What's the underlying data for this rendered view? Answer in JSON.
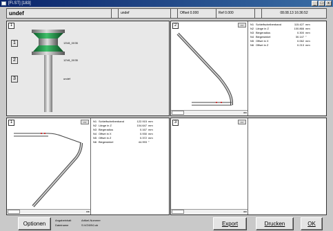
{
  "window": {
    "title": "[Fl.ST] [183]",
    "min_label": "_",
    "max_label": "□",
    "close_label": "x"
  },
  "header": {
    "title": "undef",
    "field1": "",
    "field2": "undef",
    "field3": "",
    "offset": "Offset 0.000",
    "ref": "Ref 0.000",
    "field6": "",
    "datetime": "08.08.13 16:36:52"
  },
  "panel1": {
    "number": "1",
    "items": [
      {
        "num": "1",
        "label": "13V8_0X35"
      },
      {
        "num": "2",
        "label": "12V8_0X35"
      },
      {
        "num": "3",
        "label": "undef"
      }
    ]
  },
  "panel2": {
    "number": "2",
    "expand_label": ">>",
    "scroll_label": "",
    "scroll_arrows": "◂ ▸",
    "rows": [
      {
        "k": "N1",
        "label": "Schleifscheibenband",
        "value": "115.427",
        "unit": "mm"
      },
      {
        "k": "N2",
        "label": "Länge in Z",
        "value": "100.866",
        "unit": "mm"
      },
      {
        "k": "N3",
        "label": "Biegeradius",
        "value": "0.300",
        "unit": "mm"
      },
      {
        "k": "N4",
        "label": "Biegewinkel",
        "value": "30.147",
        "unit": "°"
      },
      {
        "k": "N5",
        "label": "Offset in X",
        "value": "0.062",
        "unit": "mm"
      },
      {
        "k": "N6",
        "label": "Offset in Z",
        "value": "0.213",
        "unit": "mm"
      }
    ]
  },
  "panel3": {
    "number": "1",
    "expand_label": ">>",
    "scroll_label": "",
    "scroll_arrows": "◂ ▸",
    "rows": [
      {
        "k": "N1",
        "label": "Schleifscheibenband",
        "value": "122.915",
        "unit": "mm"
      },
      {
        "k": "N2",
        "label": "Länge in Z",
        "value": "104.647",
        "unit": "mm"
      },
      {
        "k": "N3",
        "label": "Biegeradius",
        "value": "0.167",
        "unit": "mm"
      },
      {
        "k": "N4",
        "label": "Offset in X",
        "value": "0.930",
        "unit": "mm"
      },
      {
        "k": "N5",
        "label": "Offset in Z",
        "value": "0.372",
        "unit": "mm"
      },
      {
        "k": "N6",
        "label": "Biegewinkel",
        "value": "44.993",
        "unit": "°"
      }
    ]
  },
  "panel4": {
    "number": "3",
    "expand_label": ">>",
    "scroll_arrows": "◂ ▸"
  },
  "footer": {
    "options_label": "Optionen",
    "info_k1": "Angabeinhalt",
    "info_v1": "Artikel-Nummer",
    "info_k2": "Dateiname",
    "info_v2": "S:\\V2\\09\\0.ob",
    "export_label": "Export",
    "print_label": "Drucken",
    "ok_label": "OK"
  }
}
